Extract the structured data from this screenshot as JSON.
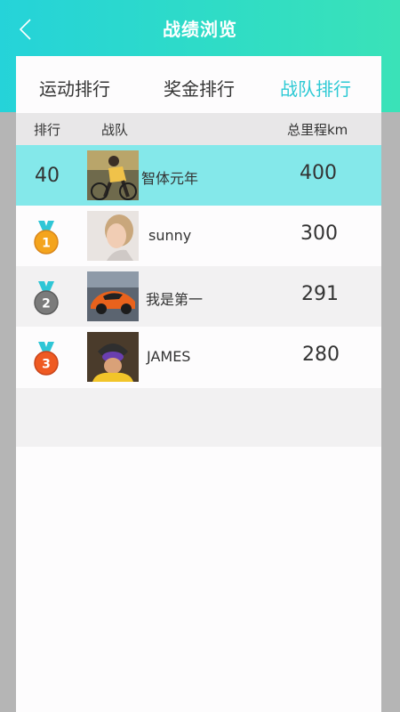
{
  "header": {
    "title": "战绩浏览",
    "back_icon": "chevron-left-icon"
  },
  "tabs": [
    {
      "label": "运动排行",
      "active": false
    },
    {
      "label": "奖金排行",
      "active": false
    },
    {
      "label": "战队排行",
      "active": true
    }
  ],
  "columns": {
    "rank": "排行",
    "team": "战队",
    "distance": "总里程km"
  },
  "rows": [
    {
      "rank": "40",
      "name": "智体元年",
      "km": "400",
      "highlight": true,
      "medal": null,
      "avatar": "cyclist-avatar"
    },
    {
      "rank": "1",
      "name": "sunny",
      "km": "300",
      "highlight": false,
      "medal": "gold",
      "avatar": "woman-avatar"
    },
    {
      "rank": "2",
      "name": "我是第一",
      "km": "291",
      "highlight": false,
      "medal": "silver",
      "avatar": "sports-car-avatar"
    },
    {
      "rank": "3",
      "name": "JAMES",
      "km": "280",
      "highlight": false,
      "medal": "bronze",
      "avatar": "helmet-rider-avatar"
    }
  ],
  "colors": {
    "accent": "#2cc9d4",
    "highlight_row": "#84e8ea",
    "gold": "#f4a41d",
    "silver": "#7b7b7b",
    "bronze": "#ef5a22",
    "ribbon": "#2fc6d6"
  }
}
